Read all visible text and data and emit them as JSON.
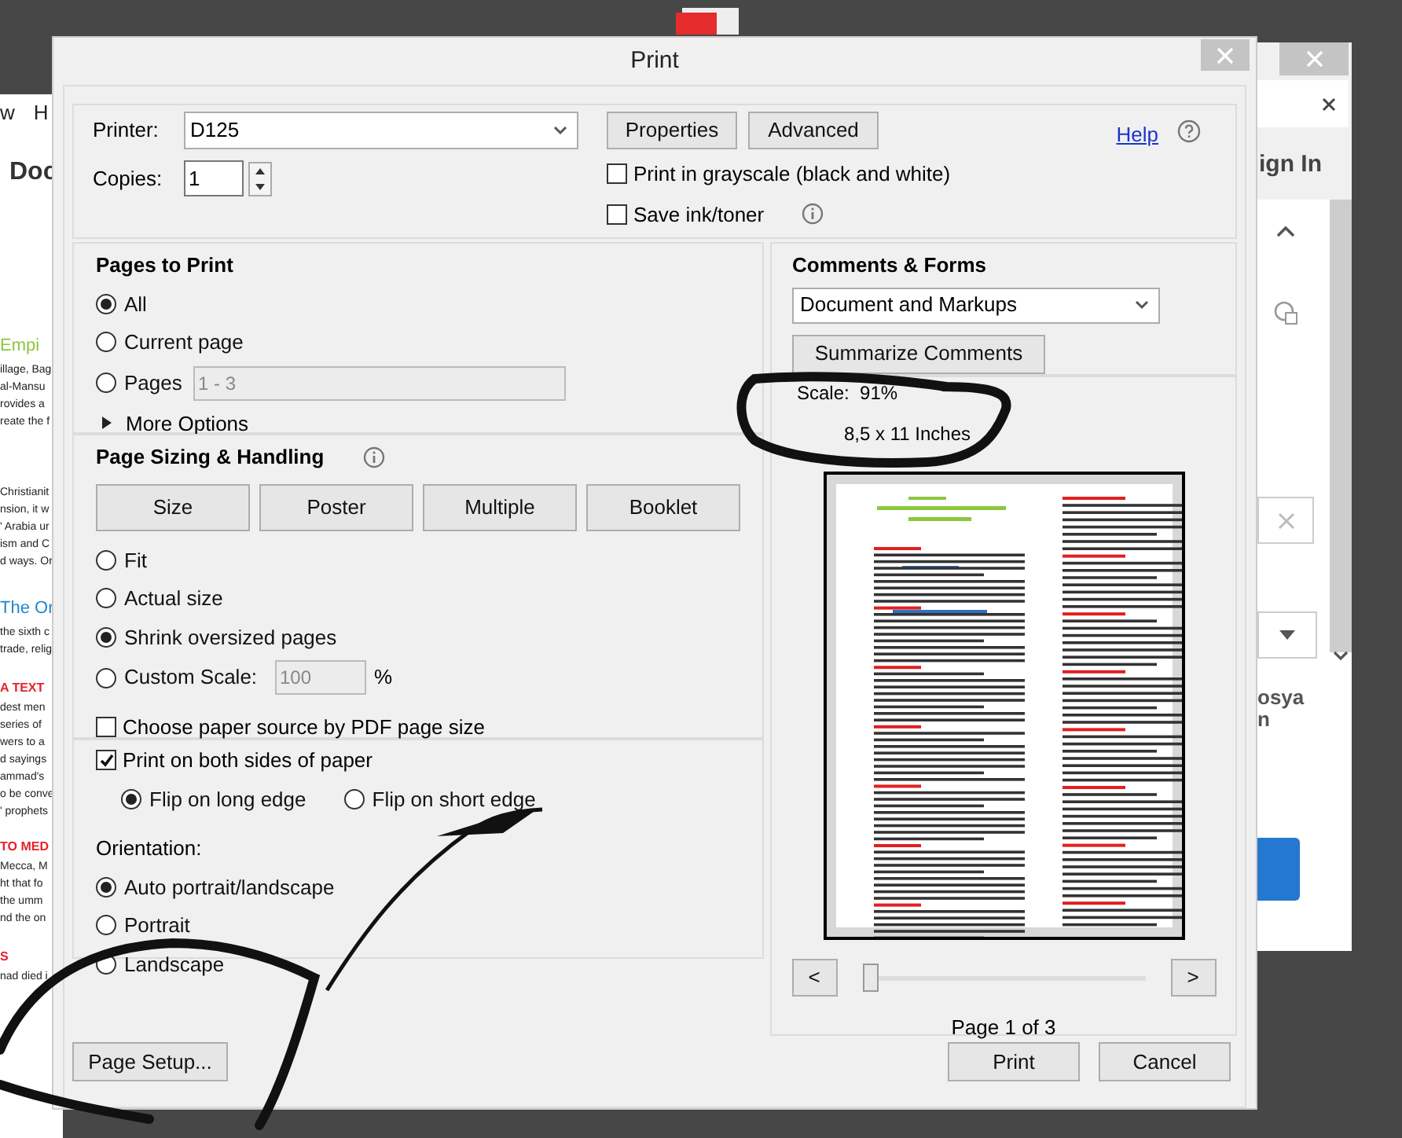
{
  "window": {
    "title": "Print"
  },
  "printer": {
    "label": "Printer:",
    "value": "D125"
  },
  "top_buttons": [
    "Properties",
    "Advanced"
  ],
  "help": "Help",
  "copies": {
    "label": "Copies:",
    "value": "1"
  },
  "options": [
    {
      "label": "Print in grayscale (black and white)",
      "checked": false,
      "info": false
    },
    {
      "label": "Save ink/toner",
      "checked": false,
      "info": true
    }
  ],
  "pages_to_print": {
    "title": "Pages to Print",
    "choices": [
      {
        "label": "All",
        "selected": true
      },
      {
        "label": "Current page",
        "selected": false
      },
      {
        "label": "Pages",
        "selected": false,
        "value": "1 - 3"
      }
    ],
    "more": "More Options"
  },
  "sizing": {
    "title": "Page Sizing & Handling",
    "modes": [
      "Size",
      "Poster",
      "Multiple",
      "Booklet"
    ],
    "choices": [
      {
        "label": "Fit",
        "selected": false
      },
      {
        "label": "Actual size",
        "selected": false
      },
      {
        "label": "Shrink oversized pages",
        "selected": true
      },
      {
        "label": "Custom Scale:",
        "selected": false,
        "value": "100",
        "unit": "%"
      }
    ],
    "paper_source": {
      "label": "Choose paper source by PDF page size",
      "checked": false
    }
  },
  "duplex": {
    "label": "Print on both sides of paper",
    "checked": true,
    "choices": [
      {
        "label": "Flip on long edge",
        "selected": true
      },
      {
        "label": "Flip on short edge",
        "selected": false
      }
    ]
  },
  "orientation": {
    "title": "Orientation:",
    "choices": [
      {
        "label": "Auto portrait/landscape",
        "selected": true
      },
      {
        "label": "Portrait",
        "selected": false
      },
      {
        "label": "Landscape",
        "selected": false
      }
    ]
  },
  "page_setup": "Page Setup...",
  "comments": {
    "title": "Comments & Forms",
    "value": "Document and Markups",
    "button": "Summarize Comments"
  },
  "preview": {
    "scale": "Scale:  91%",
    "paper": "8,5 x 11 Inches",
    "prev": "<",
    "next": ">",
    "level": 0,
    "page_label": "Page 1 of 3"
  },
  "actions": [
    "Print",
    "Cancel"
  ],
  "background_left": {
    "menu": [
      "w",
      "H"
    ],
    "tab": "Doc",
    "groups": [
      {
        "heading": "Empi",
        "kind": "title",
        "color": "#8cc63f",
        "lines": [
          "illage, Bag",
          "al-Mansu",
          "rovides a",
          "reate the f"
        ]
      },
      {
        "lines": [
          "Christianit",
          "nsion, it w",
          "' Arabia ur",
          "ism and C",
          "d ways. Or"
        ]
      },
      {
        "heading": "The Or",
        "kind": "title",
        "color": "#1e88c8",
        "lines": [
          "the sixth c",
          "trade, relig"
        ]
      },
      {
        "heading": "A TEXT",
        "kind": "label",
        "color": "#e8202a",
        "lines": [
          "dest men",
          "series of",
          "wers to a",
          "d sayings",
          "ammad's",
          "o be conve",
          "' prophets"
        ]
      },
      {
        "heading": "TO MED",
        "kind": "label",
        "color": "#e8202a",
        "lines": [
          "Mecca, M",
          "ht that fo",
          "the umm",
          "nd the on"
        ]
      },
      {
        "heading": "S",
        "kind": "label",
        "color": "#e8202a",
        "lines": [
          "nad died i"
        ]
      }
    ]
  },
  "background_right": {
    "sign_in": "ign In",
    "lines": [
      "osya",
      "n"
    ]
  }
}
